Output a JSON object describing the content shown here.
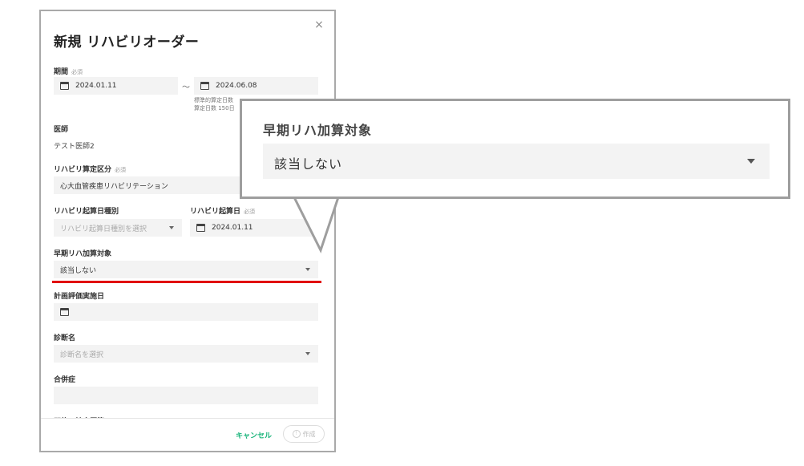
{
  "dialog": {
    "title": "新規 リハビリオーダー",
    "close_icon": "×",
    "period": {
      "label": "期間",
      "required": "必須",
      "start": "2024.01.11",
      "separator": "～",
      "end": "2024.06.08",
      "hint_line1": "標準的算定日数",
      "hint_line2": "算定日数 150日"
    },
    "doctor": {
      "label": "医師",
      "value": "テスト医師2"
    },
    "rehab_category": {
      "label": "リハビリ算定区分",
      "required": "必須",
      "value": "心大血管疾患リハビリテーション"
    },
    "start_type": {
      "label": "リハビリ起算日種別",
      "placeholder": "リハビリ起算日種別を選択"
    },
    "start_date": {
      "label": "リハビリ起算日",
      "required": "必須",
      "value": "2024.01.11"
    },
    "early_rehab": {
      "label": "早期リハ加算対象",
      "value": "該当しない"
    },
    "plan_eval_date": {
      "label": "計画評価実施日"
    },
    "diagnosis": {
      "label": "診断名",
      "placeholder": "診断名を選択"
    },
    "complication": {
      "label": "合併症"
    },
    "cut_label": "既往・社会歴等",
    "footer": {
      "cancel": "キャンセル",
      "create": "作成",
      "create_icon": "!"
    }
  },
  "callout": {
    "label": "早期リハ加算対象",
    "value": "該当しない"
  },
  "colors": {
    "highlight_underline": "#e10000",
    "cancel_text": "#19b47a"
  }
}
